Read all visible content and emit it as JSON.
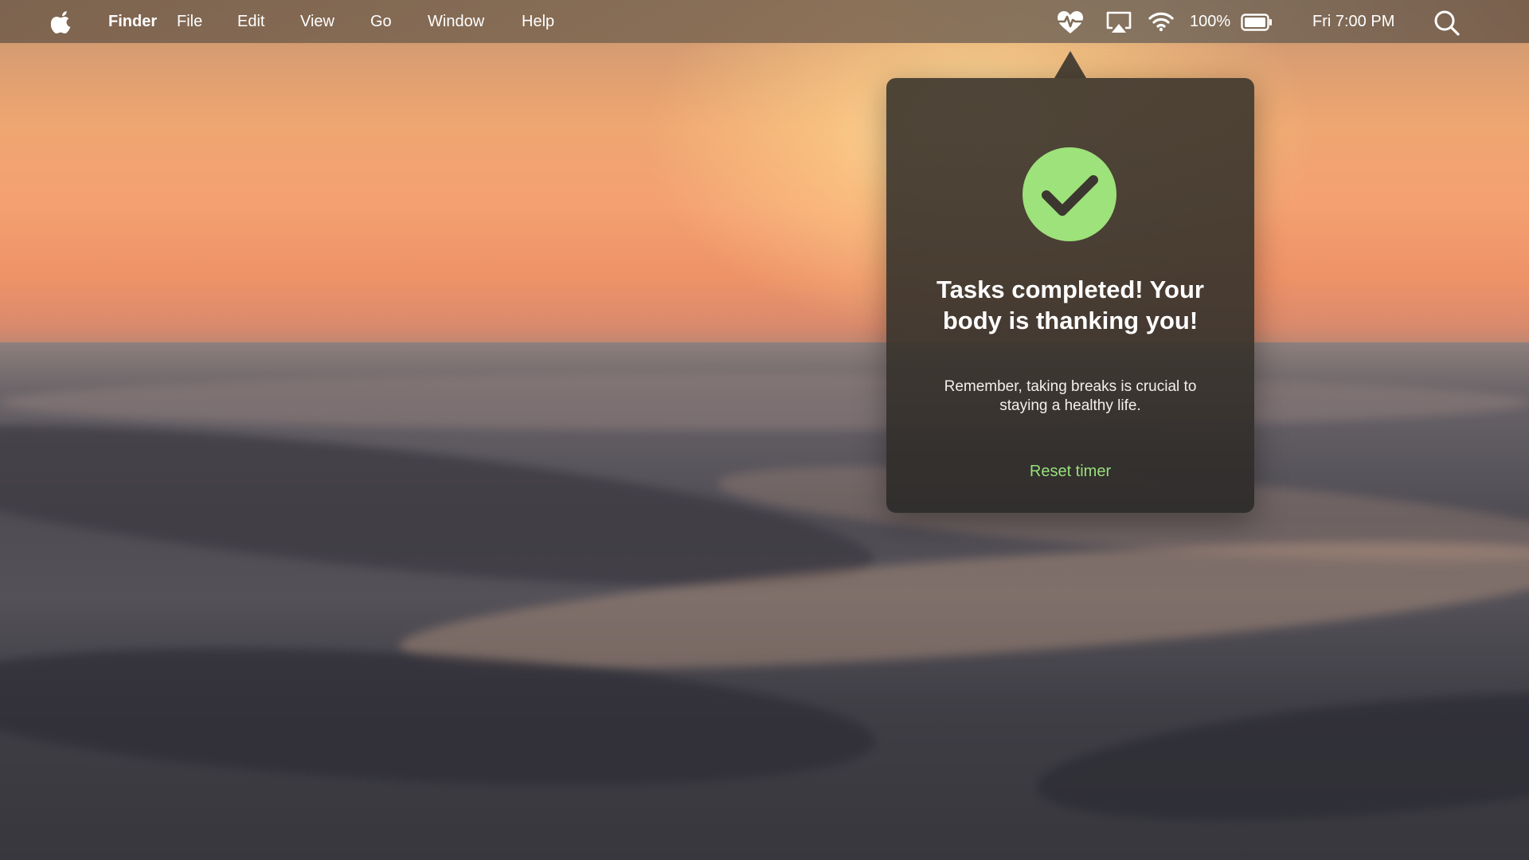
{
  "menubar": {
    "apple_icon": "apple-logo-icon",
    "app_name": "Finder",
    "menus": [
      "File",
      "Edit",
      "View",
      "Go",
      "Window",
      "Help"
    ],
    "status": {
      "health_icon": "heart-pulse-icon",
      "airplay_icon": "airplay-icon",
      "wifi_icon": "wifi-icon",
      "battery_percent": "100%",
      "battery_icon": "battery-full-icon",
      "clock": "Fri 7:00 PM",
      "spotlight_icon": "search-icon"
    }
  },
  "popover": {
    "status_icon": "checkmark-circle-icon",
    "title": "Tasks completed! Your body is thanking you!",
    "message": "Remember, taking breaks is crucial to staying a healthy life.",
    "action_label": "Reset timer",
    "accent_color": "#98e07a",
    "check_color": "#9de27a"
  }
}
